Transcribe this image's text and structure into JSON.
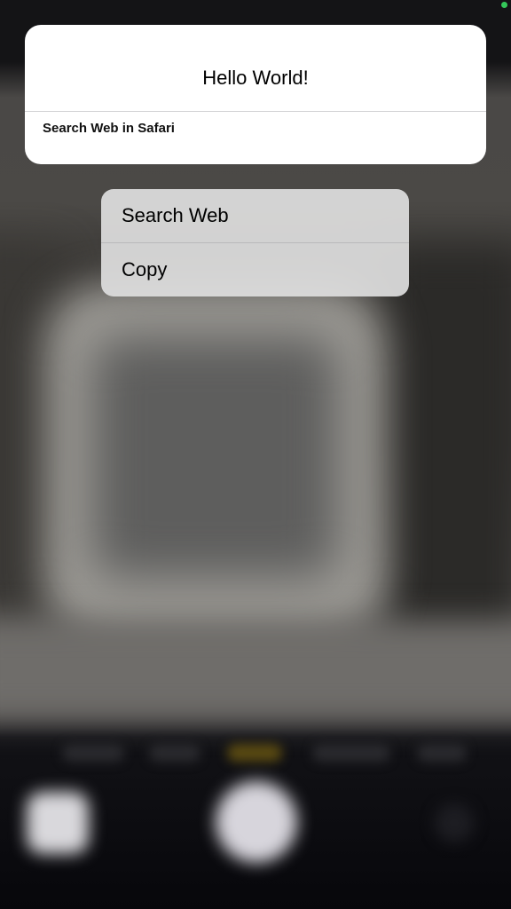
{
  "preview": {
    "title": "Hello World!",
    "caption": "Search Web in Safari"
  },
  "menu": {
    "items": [
      {
        "label": "Search Web"
      },
      {
        "label": "Copy"
      }
    ]
  },
  "colors": {
    "card_background": "#ffffff",
    "menu_background": "#dedede",
    "recording_indicator": "#34c759"
  },
  "icons": {
    "status": "recording-indicator-dot"
  }
}
